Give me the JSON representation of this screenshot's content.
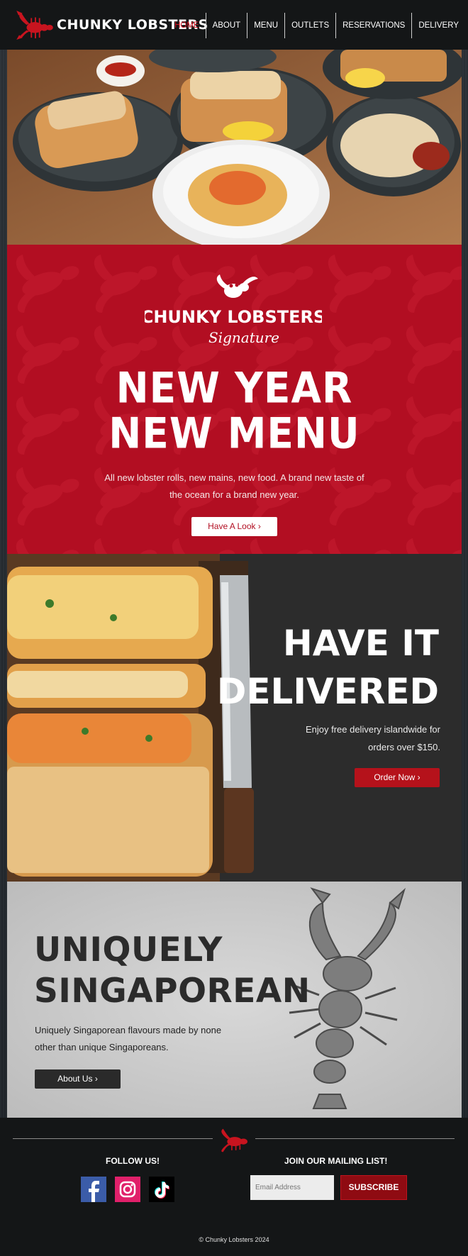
{
  "brand": {
    "name": "CHUNKY LOBSTERS",
    "logo_icon": "lobster-icon"
  },
  "nav": {
    "items": [
      {
        "label": "HOME",
        "active": true
      },
      {
        "label": "ABOUT",
        "active": false
      },
      {
        "label": "MENU",
        "active": false
      },
      {
        "label": "OUTLETS",
        "active": false
      },
      {
        "label": "RESERVATIONS",
        "active": false
      },
      {
        "label": "DELIVERY",
        "active": false
      }
    ]
  },
  "promo": {
    "logo_text": "CHUNKY LOBSTERS",
    "logo_script": "Signature",
    "headline": [
      "NEW YEAR",
      "NEW MENU"
    ],
    "body": "All new lobster rolls, new mains, new food. A brand new taste of the ocean for a brand new year.",
    "button": "Have A Look"
  },
  "delivery": {
    "headline": [
      "HAVE IT",
      "DELIVERED"
    ],
    "body": "Enjoy free delivery islandwide for orders over $150.",
    "button": "Order Now"
  },
  "unique": {
    "headline": [
      "UNIQUELY",
      "SINGAPOREAN"
    ],
    "body": "Uniquely Singaporean flavours made by none other than unique Singaporeans.",
    "button": "About Us"
  },
  "footer": {
    "follow_label": "FOLLOW US!",
    "mailing_label": "JOIN OUR MAILING LIST!",
    "socials": [
      "facebook-icon",
      "instagram-icon",
      "tiktok-icon"
    ],
    "email_placeholder": "Email Address",
    "subscribe_button": "SUBSCRIBE",
    "copyright": "© Chunky Lobsters 2024"
  },
  "colors": {
    "brand_red": "#b20e22",
    "dark": "#141617",
    "active_nav": "#d0101f"
  }
}
